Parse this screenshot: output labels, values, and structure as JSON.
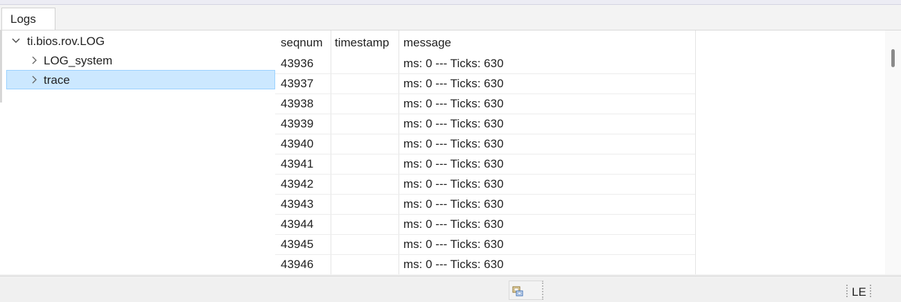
{
  "tab": {
    "label": "Logs"
  },
  "tree": {
    "root": {
      "label": "ti.bios.rov.LOG",
      "expanded": true
    },
    "children": [
      {
        "label": "LOG_system",
        "selected": false
      },
      {
        "label": "trace",
        "selected": true
      }
    ]
  },
  "table": {
    "columns": [
      "seqnum",
      "timestamp",
      "message"
    ],
    "rows": [
      {
        "seqnum": "43936",
        "timestamp": "",
        "message": "ms: 0 --- Ticks: 630"
      },
      {
        "seqnum": "43937",
        "timestamp": "",
        "message": "ms: 0 --- Ticks: 630"
      },
      {
        "seqnum": "43938",
        "timestamp": "",
        "message": "ms: 0 --- Ticks: 630"
      },
      {
        "seqnum": "43939",
        "timestamp": "",
        "message": "ms: 0 --- Ticks: 630"
      },
      {
        "seqnum": "43940",
        "timestamp": "",
        "message": "ms: 0 --- Ticks: 630"
      },
      {
        "seqnum": "43941",
        "timestamp": "",
        "message": "ms: 0 --- Ticks: 630"
      },
      {
        "seqnum": "43942",
        "timestamp": "",
        "message": "ms: 0 --- Ticks: 630"
      },
      {
        "seqnum": "43943",
        "timestamp": "",
        "message": "ms: 0 --- Ticks: 630"
      },
      {
        "seqnum": "43944",
        "timestamp": "",
        "message": "ms: 0 --- Ticks: 630"
      },
      {
        "seqnum": "43945",
        "timestamp": "",
        "message": "ms: 0 --- Ticks: 630"
      },
      {
        "seqnum": "43946",
        "timestamp": "",
        "message": "ms: 0 --- Ticks: 630"
      }
    ]
  },
  "statusbar": {
    "encoding": "LE",
    "icon": "connection-icon"
  },
  "colors": {
    "selection_bg": "#cce8ff",
    "selection_border": "#99d1ff",
    "scroll_thumb": "#8a8a8a"
  }
}
